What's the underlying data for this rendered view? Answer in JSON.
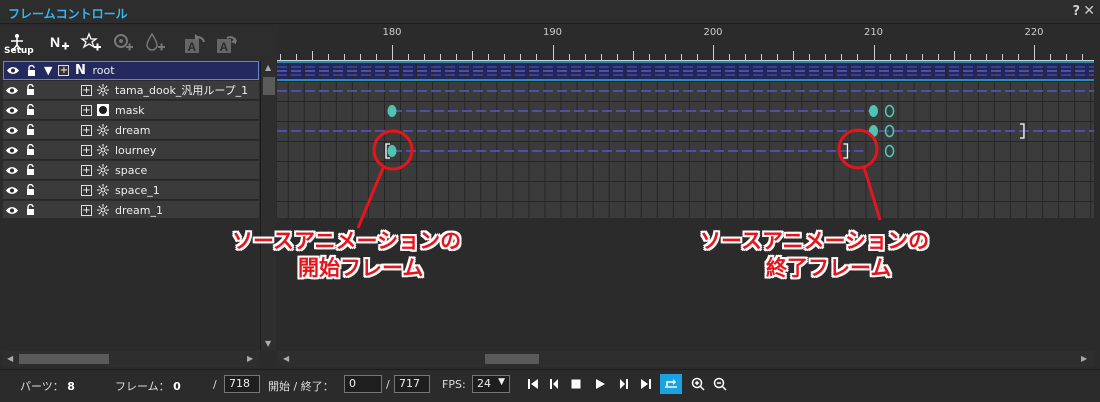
{
  "window": {
    "title": "フレームコントロール",
    "help": "?",
    "close": "✕"
  },
  "toolbar": {
    "setup_label": "Setup",
    "tools": [
      "setup-icon",
      "add-null-icon",
      "add-effect-icon",
      "add-partial-icon",
      "add-mask-icon",
      "rotate-a-icon",
      "rotate-a-alt-icon"
    ]
  },
  "ruler": {
    "labels": [
      {
        "frame": 180,
        "text": "180"
      },
      {
        "frame": 190,
        "text": "190"
      },
      {
        "frame": 200,
        "text": "200"
      },
      {
        "frame": 210,
        "text": "210"
      },
      {
        "frame": 220,
        "text": "220"
      }
    ],
    "first_frame": 173,
    "last_frame": 224
  },
  "layers": [
    {
      "name": "root",
      "type": "null",
      "indent": 0,
      "selected": true,
      "expanded": true
    },
    {
      "name": "tama_dook_汎用ループ_1",
      "type": "effect",
      "indent": 1,
      "selected": false
    },
    {
      "name": "mask",
      "type": "mask",
      "indent": 1,
      "selected": false
    },
    {
      "name": "dream",
      "type": "effect",
      "indent": 1,
      "selected": false
    },
    {
      "name": "lourney",
      "type": "effect",
      "indent": 1,
      "selected": false
    },
    {
      "name": "space",
      "type": "effect",
      "indent": 1,
      "selected": false
    },
    {
      "name": "space_1",
      "type": "effect",
      "indent": 1,
      "selected": false
    },
    {
      "name": "dream_1",
      "type": "effect",
      "indent": 1,
      "selected": false
    }
  ],
  "annotations": {
    "start": {
      "line1": "ソースアニメーションの",
      "line2": "開始フレーム"
    },
    "end": {
      "line1": "ソースアニメーションの",
      "line2": "終了フレーム"
    }
  },
  "status": {
    "parts_label": "パーツ：",
    "parts_value": "8",
    "frame_label": "フレーム：",
    "frame_value": "0",
    "frame_total_sep": "/",
    "frame_total": "718",
    "range_label": "開始 / 終了：",
    "range_start": "0",
    "range_sep": "/",
    "range_end": "717",
    "fps_label": "FPS:",
    "fps_value": "24"
  },
  "colors": {
    "accent": "#35b6f0",
    "callout": "#e8141b",
    "keyframe": "#4fc4b4",
    "track_line": "#4d4fa8",
    "loop_active": "#1aa3e0"
  }
}
